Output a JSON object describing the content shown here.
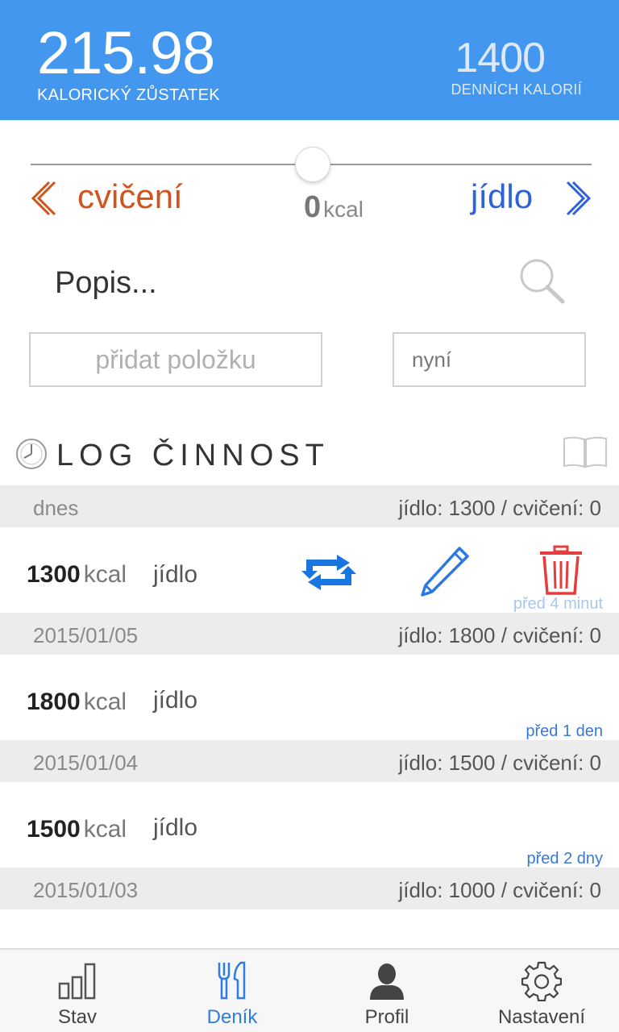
{
  "header": {
    "balance_value": "215.98",
    "balance_label": "KALORICKÝ ZŮSTATEK",
    "daily_value": "1400",
    "daily_label": "DENNÍCH KALORIÍ",
    "background_color": "#4497ee"
  },
  "slider": {
    "exercise_label": "cvičení",
    "food_label": "jídlo",
    "kcal_value": "0",
    "kcal_unit": "kcal",
    "level_fraction": 0.5,
    "exercise_color": "#d2541c",
    "food_color": "#2d62d8"
  },
  "description": {
    "placeholder": "Popis...",
    "search_icon": "search-icon"
  },
  "inputs": {
    "add_item_placeholder": "přidat položku",
    "time_value": "nyní"
  },
  "log": {
    "title": "LOG ČINNOST",
    "days": [
      {
        "date": "dnes",
        "summary": "jídlo: 1300 / cvičení: 0",
        "entry": {
          "kcal": "1300",
          "unit": "kcal",
          "type": "jídlo",
          "ago": "před 4 minut"
        }
      },
      {
        "date": "2015/01/05",
        "summary": "jídlo: 1800 / cvičení: 0",
        "entry": {
          "kcal": "1800",
          "unit": "kcal",
          "type": "jídlo",
          "ago": "před 1 den"
        }
      },
      {
        "date": "2015/01/04",
        "summary": "jídlo: 1500 / cvičení: 0",
        "entry": {
          "kcal": "1500",
          "unit": "kcal",
          "type": "jídlo",
          "ago": "před 2 dny"
        }
      },
      {
        "date": "2015/01/03",
        "summary": "jídlo: 1000 / cvičení: 0"
      }
    ],
    "row_actions": [
      "repeat-icon",
      "edit-icon",
      "trash-icon"
    ]
  },
  "nav": {
    "items": [
      {
        "label": "Stav",
        "icon": "bar-chart-icon",
        "active": false
      },
      {
        "label": "Deník",
        "icon": "fork-knife-icon",
        "active": true
      },
      {
        "label": "Profil",
        "icon": "person-icon",
        "active": false
      },
      {
        "label": "Nastavení",
        "icon": "gear-icon",
        "active": false
      }
    ],
    "active_color": "#2f7de1"
  }
}
